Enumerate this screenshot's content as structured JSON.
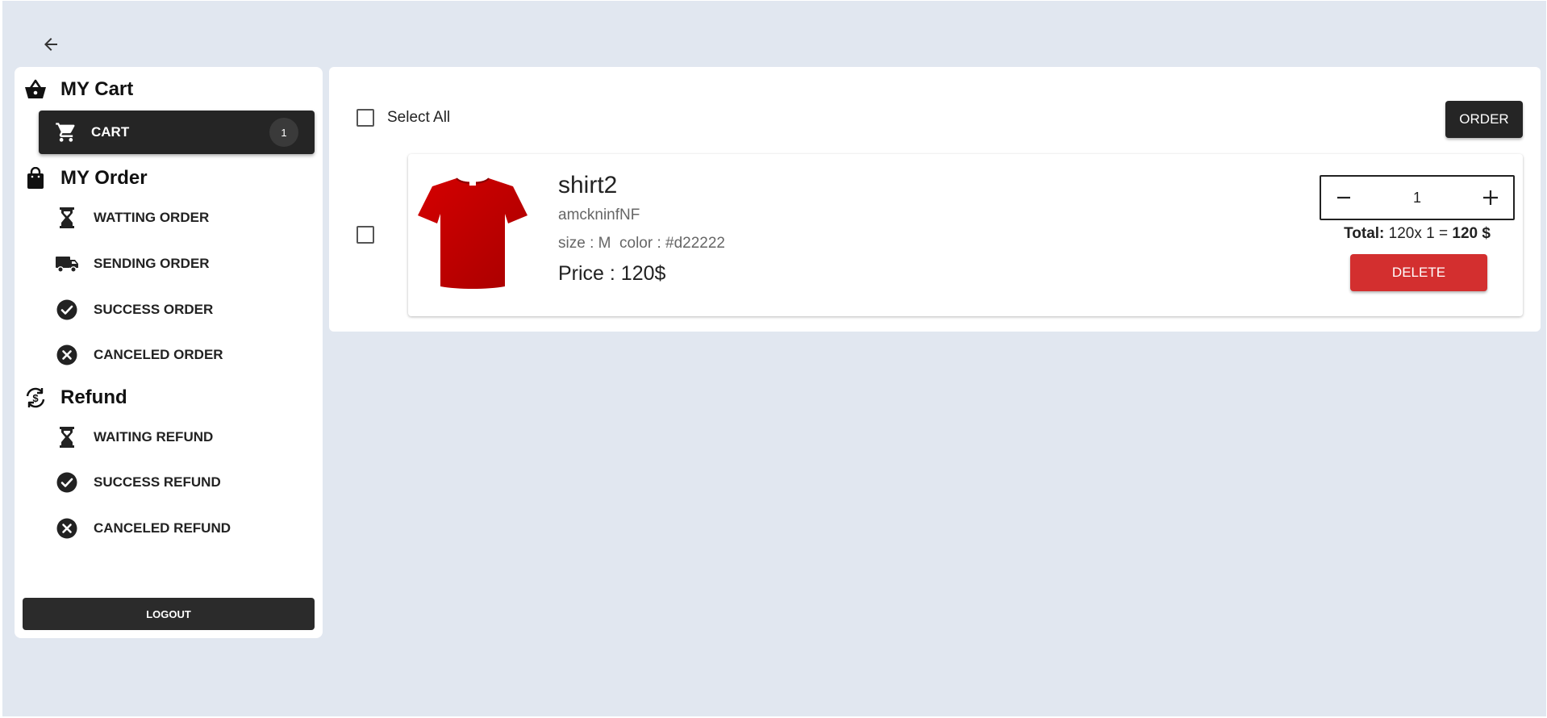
{
  "sidebar": {
    "my_cart_header": "MY Cart",
    "cart_item": {
      "label": "CART",
      "badge": "1"
    },
    "my_order_header": "MY Order",
    "order_items": [
      {
        "label": "WATTING ORDER",
        "icon": "hourglass-icon"
      },
      {
        "label": "SENDING ORDER",
        "icon": "truck-icon"
      },
      {
        "label": "SUCCESS ORDER",
        "icon": "check-circle-icon"
      },
      {
        "label": "CANCELED ORDER",
        "icon": "cancel-circle-icon"
      }
    ],
    "refund_header": "Refund",
    "refund_items": [
      {
        "label": "WAITING REFUND",
        "icon": "hourglass-icon"
      },
      {
        "label": "SUCCESS REFUND",
        "icon": "check-circle-icon"
      },
      {
        "label": "CANCELED REFUND",
        "icon": "cancel-circle-icon"
      }
    ],
    "logout_label": "LOGOUT"
  },
  "main": {
    "select_all_label": "Select All",
    "order_label": "ORDER",
    "item": {
      "name": "shirt2",
      "description": "amckninfNF",
      "attributes": "size : M  color : #d22222",
      "price": "Price : 120$",
      "quantity": "1",
      "total_label": "Total:",
      "total_expr": "120x 1 =",
      "total_value": "120 $",
      "delete_label": "DELETE",
      "shirt_color": "#c40000"
    }
  },
  "colors": {
    "background": "#e1e7f0",
    "dark": "#252525",
    "danger": "#d32f2f"
  }
}
